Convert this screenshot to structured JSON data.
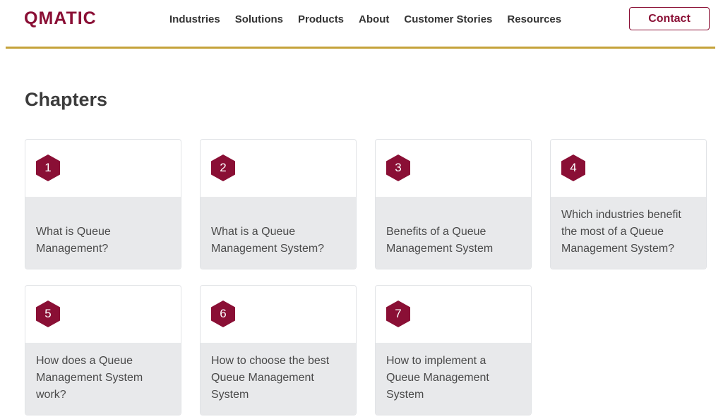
{
  "header": {
    "logo_text": "QMATIC",
    "nav": [
      "Industries",
      "Solutions",
      "Products",
      "About",
      "Customer Stories",
      "Resources"
    ],
    "contact_label": "Contact"
  },
  "main": {
    "title": "Chapters",
    "chapters": [
      {
        "number": "1",
        "text": "What is Queue Management?"
      },
      {
        "number": "2",
        "text": "What is a Queue Management System?"
      },
      {
        "number": "3",
        "text": "Benefits of a Queue Management System"
      },
      {
        "number": "4",
        "text": "Which industries benefit the most of a Queue Management System?"
      },
      {
        "number": "5",
        "text": "How does a Queue Management System work?"
      },
      {
        "number": "6",
        "text": "How to choose the best Queue Management System"
      },
      {
        "number": "7",
        "text": "How to implement a Queue Management System"
      }
    ]
  },
  "colors": {
    "brand": "#8a0f35",
    "accent_rule": "#c5a23a",
    "card_bottom": "#e8e9eb"
  },
  "icons": {
    "chapter_badge": "hexagon-number-icon"
  }
}
